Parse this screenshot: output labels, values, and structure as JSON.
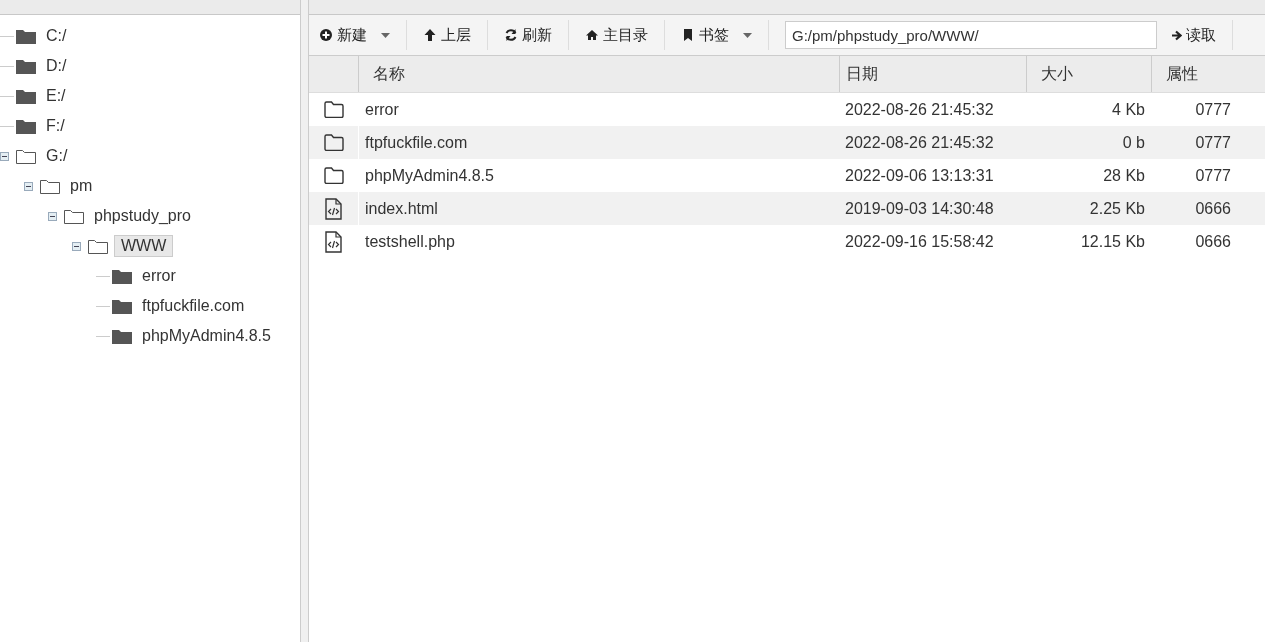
{
  "tree": [
    {
      "label": "C:/",
      "expanded": false,
      "selected": false
    },
    {
      "label": "D:/",
      "expanded": false,
      "selected": false
    },
    {
      "label": "E:/",
      "expanded": false,
      "selected": false
    },
    {
      "label": "F:/",
      "expanded": false,
      "selected": false
    },
    {
      "label": "G:/",
      "expanded": true,
      "selected": false,
      "children": [
        {
          "label": "pm",
          "expanded": true,
          "selected": false,
          "children": [
            {
              "label": "phpstudy_pro",
              "expanded": true,
              "selected": false,
              "children": [
                {
                  "label": "WWW",
                  "expanded": true,
                  "selected": true,
                  "children": [
                    {
                      "label": "error",
                      "expanded": false,
                      "selected": false
                    },
                    {
                      "label": "ftpfuckfile.com",
                      "expanded": false,
                      "selected": false
                    },
                    {
                      "label": "phpMyAdmin4.8.5",
                      "expanded": false,
                      "selected": false
                    }
                  ]
                }
              ]
            }
          ]
        }
      ]
    }
  ],
  "toolbar": {
    "buttons": [
      {
        "label": "新建",
        "dropdown": true
      },
      {
        "label": "上层",
        "dropdown": false
      },
      {
        "label": "刷新",
        "dropdown": false
      },
      {
        "label": "主目录",
        "dropdown": false
      },
      {
        "label": "书签",
        "dropdown": true
      }
    ],
    "path": "G:/pm/phpstudy_pro/WWW/",
    "go": "读取"
  },
  "table": {
    "columns": [
      "名称",
      "日期",
      "大小",
      "属性"
    ],
    "rows": [
      {
        "kind": "folder",
        "name": "error",
        "date": "2022-08-26 21:45:32",
        "size": "4 Kb",
        "attr": "0777"
      },
      {
        "kind": "folder",
        "name": "ftpfuckfile.com",
        "date": "2022-08-26 21:45:32",
        "size": "0 b",
        "attr": "0777"
      },
      {
        "kind": "folder",
        "name": "phpMyAdmin4.8.5",
        "date": "2022-09-06 13:13:31",
        "size": "28 Kb",
        "attr": "0777"
      },
      {
        "kind": "file",
        "name": "index.html",
        "date": "2019-09-03 14:30:48",
        "size": "2.25 Kb",
        "attr": "0666"
      },
      {
        "kind": "file",
        "name": "testshell.php",
        "date": "2022-09-16 15:58:42",
        "size": "12.15 Kb",
        "attr": "0666"
      }
    ]
  }
}
